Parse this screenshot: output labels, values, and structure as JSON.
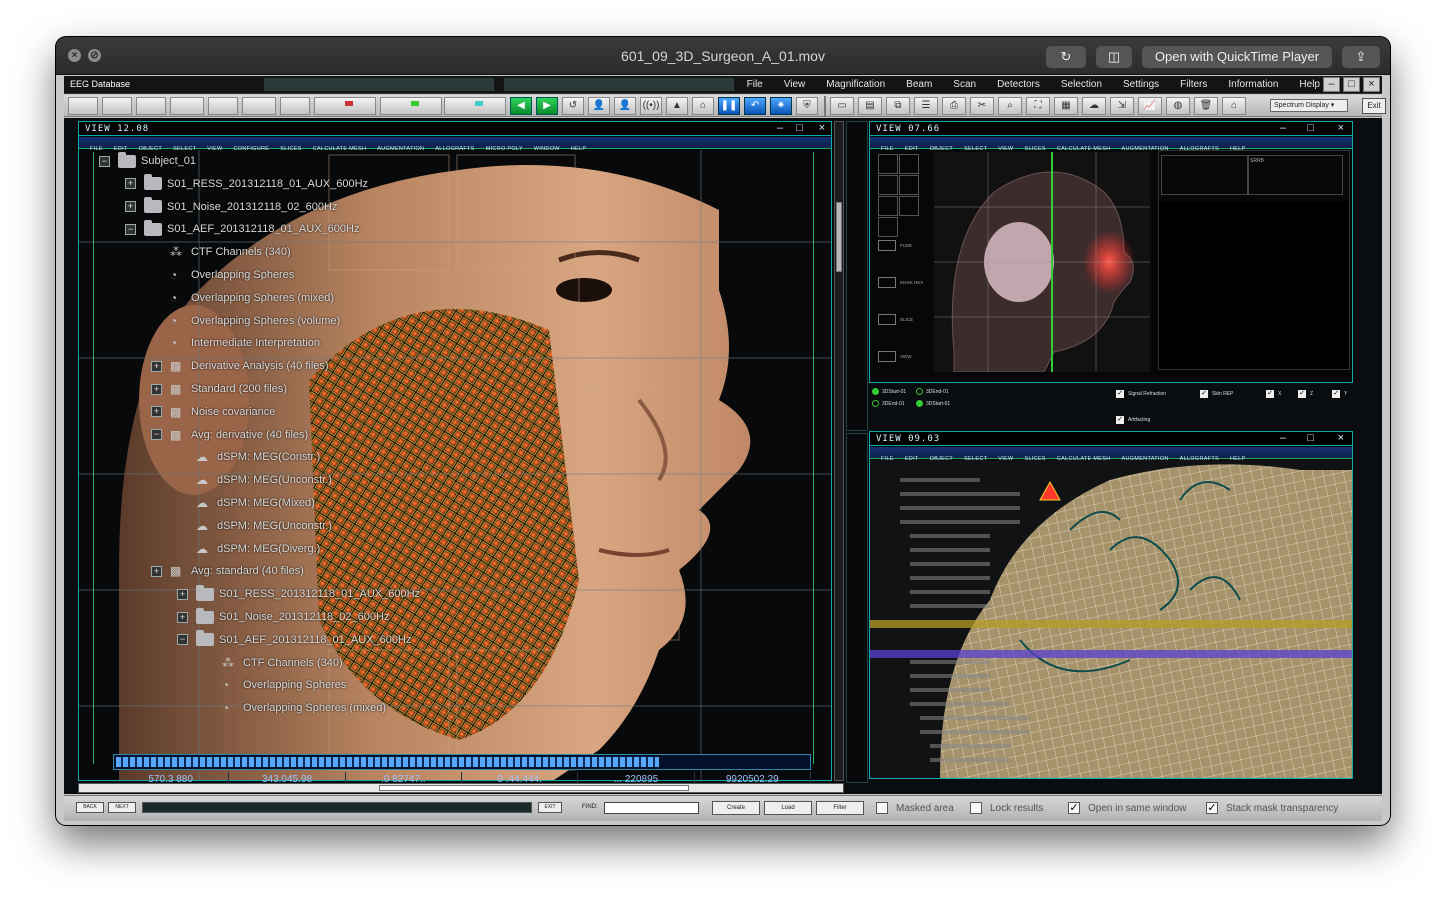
{
  "window": {
    "title": "601_09_3D_Surgeon_A_01.mov",
    "open_with": "Open with QuickTime Player"
  },
  "app": {
    "database_name": "EEG Database",
    "menu": [
      "File",
      "View",
      "Magnification",
      "Beam",
      "Scan",
      "Detectors",
      "Selection",
      "Settings",
      "Filters",
      "Information",
      "Help"
    ],
    "spectrum_select": "Spectrum Display",
    "exit_label": "Exit"
  },
  "view1": {
    "title": "VIEW 12.08",
    "menu": [
      "FILE",
      "EDIT",
      "OBJECT",
      "SELECT",
      "VIEW",
      "CONFIGURE",
      "SLICES",
      "CALCULATE MESH",
      "AUGMENTATION",
      "ALLOGRAFTS",
      "MICRO POLY",
      "WINDOW",
      "HELP"
    ],
    "tree": [
      {
        "label": "Subject_01",
        "kind": "folder",
        "toggle": "−",
        "level": 0
      },
      {
        "label": "S01_RESS_201312118_01_AUX_600Hz",
        "kind": "folder",
        "toggle": "+",
        "level": 1
      },
      {
        "label": "S01_Noise_201312118_02_600Hz",
        "kind": "folder",
        "toggle": "+",
        "level": 1
      },
      {
        "label": "S01_AEF_201312118_01_AUX_600Hz",
        "kind": "folder",
        "toggle": "−",
        "level": 1
      },
      {
        "label": "CTF Channels (340)",
        "kind": "channel",
        "toggle": "",
        "level": 2
      },
      {
        "label": "Overlapping Spheres",
        "kind": "head",
        "toggle": "",
        "level": 2
      },
      {
        "label": "Overlapping Spheres (mixed)",
        "kind": "head",
        "toggle": "",
        "level": 2
      },
      {
        "label": "Overlapping Spheres (volume)",
        "kind": "head",
        "toggle": "",
        "level": 2
      },
      {
        "label": "Intermediate Interpretation",
        "kind": "head",
        "toggle": "",
        "level": 2
      },
      {
        "label": "Derivative Analysis (40 files)",
        "kind": "data",
        "toggle": "+",
        "level": 2
      },
      {
        "label": "Standard (200 files)",
        "kind": "data",
        "toggle": "+",
        "level": 2
      },
      {
        "label": "Noise covariance",
        "kind": "data",
        "toggle": "+",
        "level": 2
      },
      {
        "label": "Avg: derivative (40 files)",
        "kind": "data",
        "toggle": "−",
        "level": 2
      },
      {
        "label": "dSPM: MEG(Constr.)",
        "kind": "brain",
        "toggle": "",
        "level": 3
      },
      {
        "label": "dSPM: MEG(Unconstr.)",
        "kind": "brain",
        "toggle": "",
        "level": 3
      },
      {
        "label": "dSPM: MEG(Mixed)",
        "kind": "brain",
        "toggle": "",
        "level": 3
      },
      {
        "label": "dSPM: MEG(Unconstr.)",
        "kind": "brain",
        "toggle": "",
        "level": 3
      },
      {
        "label": "dSPM: MEG(Diverg.)",
        "kind": "brain",
        "toggle": "",
        "level": 3
      },
      {
        "label": "Avg: standard (40 files)",
        "kind": "data",
        "toggle": "+",
        "level": 2
      },
      {
        "label": "S01_RESS_201312118_01_AUX_600Hz",
        "kind": "folder",
        "toggle": "+",
        "level": 3
      },
      {
        "label": "S01_Noise_201312118_02_600Hz",
        "kind": "folder",
        "toggle": "+",
        "level": 3
      },
      {
        "label": "S01_AEF_201312118_01_AUX_600Hz",
        "kind": "folder",
        "toggle": "−",
        "level": 3
      },
      {
        "label": "CTF Channels (340)",
        "kind": "channel",
        "toggle": "",
        "level": 4
      },
      {
        "label": "Overlapping Spheres",
        "kind": "head",
        "toggle": "",
        "level": 4
      },
      {
        "label": "Overlapping Spheres (mixed)",
        "kind": "head",
        "toggle": "",
        "level": 4
      }
    ],
    "readouts": [
      "570.3  880",
      "343.045.98",
      ".0 82747..",
      "0 .44.444.",
      "... 220895",
      "9920502.29"
    ],
    "progress": 0.78
  },
  "view2": {
    "title": "VIEW 07.66",
    "menu": [
      "FILE",
      "EDIT",
      "OBJECT",
      "SELECT",
      "VIEW",
      "SLICES",
      "CALCULATE MESH",
      "AUGMENTATION",
      "ALLOGRAFTS",
      "HELP"
    ],
    "side_labels": [
      "FUSE",
      "MASK HEX",
      "SLICE",
      "VIEW"
    ],
    "radios": [
      "3DStart-01",
      "3DEnd-01",
      "3DEnd-01",
      "3DStart-01"
    ],
    "checks": [
      "Signal Refraction",
      "Skin REP",
      "X",
      "Z",
      "Y"
    ],
    "artifacting": "Artifacting"
  },
  "view3": {
    "title": "VIEW 09.03",
    "menu": [
      "FILE",
      "EDIT",
      "OBJECT",
      "SELECT",
      "VIEW",
      "SLICES",
      "CALCULATE MESH",
      "AUGMENTATION",
      "ALLOGRAFTS",
      "HELP"
    ]
  },
  "bottom": {
    "back": "BACK",
    "next": "NEXT",
    "exit": "EXIT",
    "find_label": "FIND:",
    "create": "Create",
    "load": "Load",
    "filter": "Filter",
    "checks": [
      {
        "label": "Masked area",
        "checked": false
      },
      {
        "label": "Lock results",
        "checked": false
      },
      {
        "label": "Open in same window",
        "checked": true
      },
      {
        "label": "Stack mask transparency",
        "checked": true
      }
    ]
  },
  "colors": {
    "accent": "#19a6a8",
    "menu_blue": "#16316e",
    "face_mesh": "#cf6a2a",
    "highlight_red": "#ff3a2a"
  }
}
